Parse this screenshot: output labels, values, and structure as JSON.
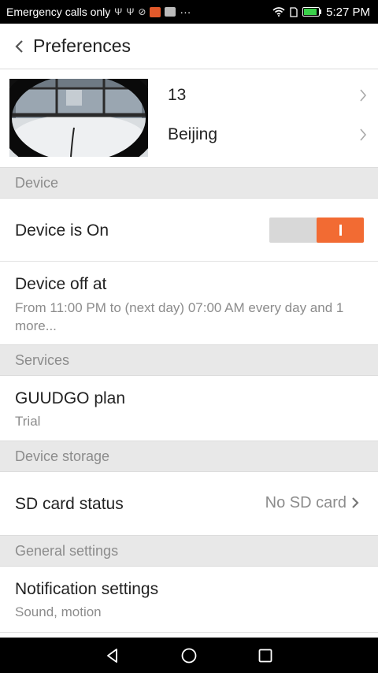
{
  "status_bar": {
    "carrier": "Emergency calls only",
    "time": "5:27 PM",
    "more": "···",
    "icons": [
      "usb-icon",
      "usb-icon",
      "sync-icon",
      "app-icon",
      "gallery-icon",
      "wifi-icon",
      "sim-icon",
      "battery-icon"
    ]
  },
  "header": {
    "title": "Preferences"
  },
  "camera": {
    "name": "13",
    "location": "Beijing"
  },
  "sections": {
    "device": "Device",
    "services": "Services",
    "storage": "Device storage",
    "general": "General settings"
  },
  "device_on": {
    "label": "Device is On",
    "enabled": true
  },
  "device_off": {
    "title": "Device off at",
    "subtitle": "From 11:00 PM to (next day) 07:00 AM every day and 1 more..."
  },
  "plan": {
    "title": "GUUDGO plan",
    "subtitle": "Trial"
  },
  "sd_card": {
    "title": "SD card status",
    "value": "No SD card"
  },
  "notification": {
    "title": "Notification settings",
    "subtitle": "Sound, motion"
  },
  "colors": {
    "accent": "#f26b33",
    "section_bg": "#e8e8e8",
    "muted_text": "#8c8c8c"
  }
}
